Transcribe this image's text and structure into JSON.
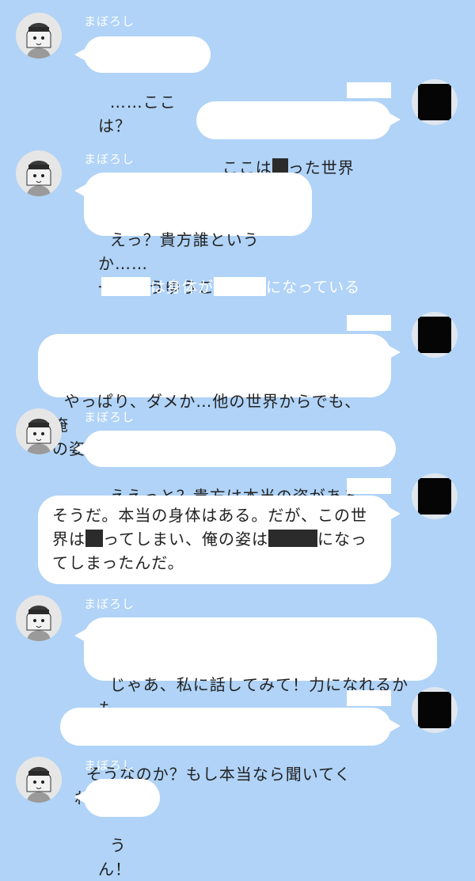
{
  "contact_name": "まぼろし",
  "messages": {
    "m1": "……ここは？",
    "m2_a": "ここは",
    "m2_b": "った世界だ。",
    "m3": "えっ？貴方誰というか……\n一体どうゆうこと？",
    "system_a": "は身体が",
    "system_b": "になっている",
    "m4": "やっぱり、ダメか…他の世界からでも、俺\nの姿は見えないのか……",
    "m5": "ええっと？貴方は本当の姿があるの？",
    "m6_line1": "そうだ。本当の身体はある。だが、この世",
    "m6_l2a": "界は",
    "m6_l2b": "ってしまい、俺の姿は",
    "m6_l2c": "になっ",
    "m6_line3": "てしまったんだ。",
    "m7": "じゃあ、私に話してみて！力になれるかも\nしれないよ！",
    "m8": "そうなのか？もし本当なら聞いてくれ。",
    "m9": "うん！"
  },
  "colors": {
    "background": "#b0d3f7",
    "bubble": "#ffffff",
    "censor": "#2b2b2b"
  },
  "icons": {
    "left_avatar": "girl-cap-avatar-icon",
    "right_avatar": "censored-avatar-icon"
  }
}
